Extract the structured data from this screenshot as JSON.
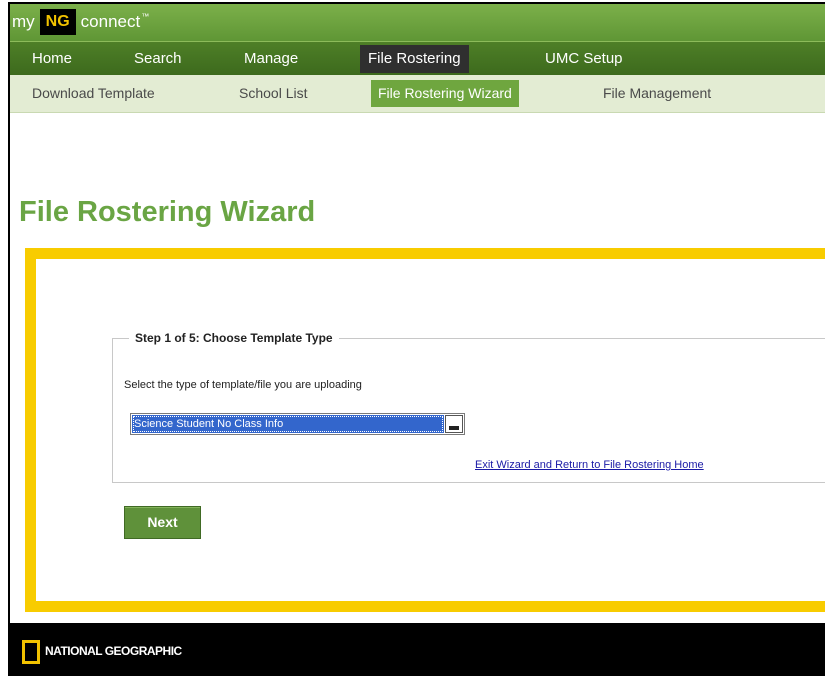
{
  "brand": {
    "my": "my",
    "ng": "NG",
    "connect": "connect",
    "tm": "™"
  },
  "main_nav": {
    "items": [
      {
        "label": "Home",
        "active": false
      },
      {
        "label": "Search",
        "active": false
      },
      {
        "label": "Manage",
        "active": false
      },
      {
        "label": "File Rostering",
        "active": true
      },
      {
        "label": "UMC Setup",
        "active": false
      }
    ]
  },
  "sub_nav": {
    "items": [
      {
        "label": "Download Template",
        "active": false
      },
      {
        "label": "School List",
        "active": false
      },
      {
        "label": "File Rostering Wizard",
        "active": true
      },
      {
        "label": "File Management",
        "active": false
      }
    ]
  },
  "page": {
    "title": "File Rostering Wizard"
  },
  "wizard": {
    "step_legend": "Step 1 of 5: Choose Template Type",
    "prompt": "Select the type of template/file you are uploading",
    "template_select": {
      "selected": "Science Student No Class Info"
    },
    "exit_link": "Exit Wizard and Return to File Rostering Home",
    "next_label": "Next"
  },
  "footer": {
    "brand": "NATIONAL GEOGRAPHIC"
  },
  "colors": {
    "brand_green": "#5f9635",
    "nav_dark_green": "#3d6a1d",
    "title_green": "#6aa544",
    "accent_yellow": "#f8cc00",
    "select_highlight": "#3366cc"
  }
}
